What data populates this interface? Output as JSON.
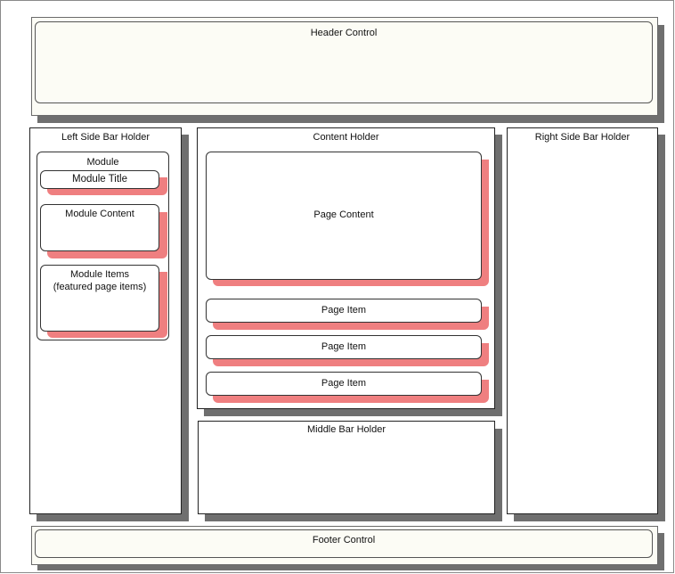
{
  "header": {
    "label": "Header Control"
  },
  "left_sidebar": {
    "label": "Left Side Bar Holder",
    "module": {
      "label": "Module",
      "title": "Module Title",
      "content": "Module Content",
      "items_line1": "Module Items",
      "items_line2": "(featured page items)"
    }
  },
  "content": {
    "label": "Content Holder",
    "page_content": "Page Content",
    "page_items": [
      "Page Item",
      "Page Item",
      "Page Item"
    ]
  },
  "right_sidebar": {
    "label": "Right Side Bar Holder"
  },
  "middle_bar": {
    "label": "Middle Bar Holder"
  },
  "footer": {
    "label": "Footer Control"
  },
  "colors": {
    "gray_shadow": "#6f6f6f",
    "pink_shadow": "#ef7f80",
    "panel_fill": "#fcfcf5"
  }
}
